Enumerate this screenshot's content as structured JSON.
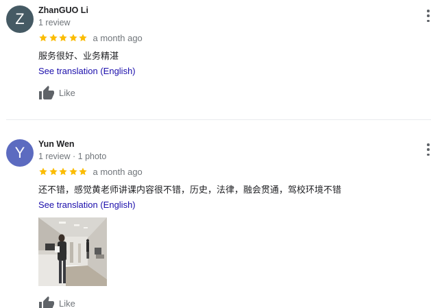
{
  "reviews": [
    {
      "avatar_letter": "Z",
      "avatar_color": "#455a64",
      "name": "ZhanGUO Li",
      "meta": "1 review",
      "rating": 5,
      "time": "a month ago",
      "text": "服务很好、业务精湛",
      "translate_label": "See translation (English)",
      "like_label": "Like",
      "more_icon": "more-vert-icon"
    },
    {
      "avatar_letter": "Y",
      "avatar_color": "#5c6bc0",
      "name": "Yun Wen",
      "meta": "1 review · 1 photo",
      "rating": 5,
      "time": "a month ago",
      "text": "还不错，感觉黄老师讲课内容很不错，历史，法律，融会贯通，驾校环境不错",
      "translate_label": "See translation (English)",
      "like_label": "Like",
      "more_icon": "more-vert-icon",
      "photo_count": 1
    }
  ],
  "colors": {
    "star": "#fbbc04",
    "link": "#1a0dab",
    "secondary_text": "#70757a",
    "divider": "#e8eaed"
  }
}
